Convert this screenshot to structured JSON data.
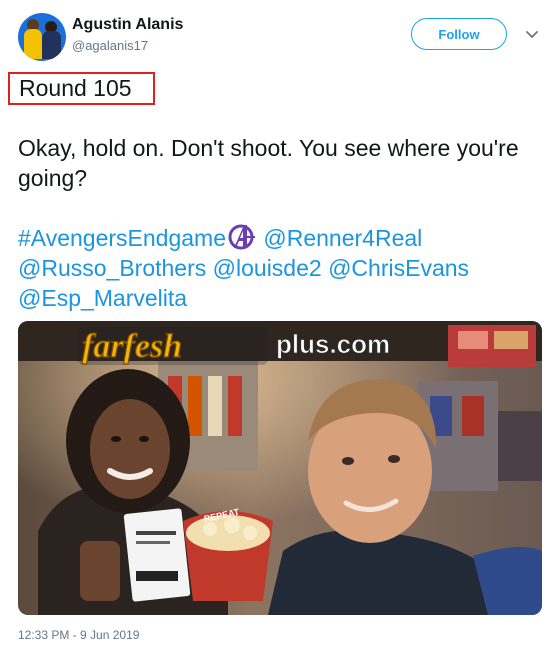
{
  "tweet": {
    "display_name": "Agustin Alanis",
    "handle": "@agalanis17",
    "follow_label": "Follow",
    "annotation": "Round 105",
    "text": "Okay, hold on. Don't shoot. You see where you're going?",
    "tags": {
      "hashtag": "#AvengersEndgame",
      "mention_1": "@Renner4Real",
      "mention_2": "@Russo_Brothers",
      "mention_3": "@louisde2",
      "mention_4": "@ChrisEvans",
      "mention_5": "@Esp_Marvelita"
    },
    "timestamp": "12:33 PM - 9 Jun 2019"
  },
  "photo": {
    "watermark_part1": "farfesh",
    "watermark_part2": "plus.com",
    "popcorn_text": "REPEAT"
  },
  "colors": {
    "link": "#1b95e0",
    "follow": "#1da1f2",
    "highlight_box": "#e0201b",
    "muted": "#657786"
  },
  "icons": [
    "chevron-down-icon",
    "avengers-logo-icon"
  ]
}
